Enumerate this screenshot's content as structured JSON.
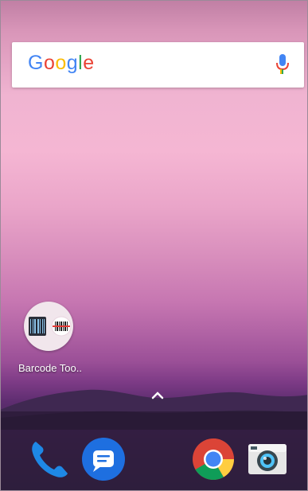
{
  "search": {
    "logo_letters": [
      "G",
      "o",
      "o",
      "g",
      "l",
      "e"
    ],
    "logo_colors": [
      "#4285F4",
      "#EA4335",
      "#FBBC05",
      "#4285F4",
      "#34A853",
      "#EA4335"
    ],
    "mic_icon": "mic-icon"
  },
  "home": {
    "app_label": "Barcode Too..",
    "app_icon": "barcode-icon"
  },
  "app_drawer": {
    "icon": "chevron-up-icon"
  },
  "dock": {
    "apps": [
      {
        "name": "phone",
        "icon": "phone-icon",
        "color": "#1E88E5"
      },
      {
        "name": "messages",
        "icon": "messages-icon",
        "color": "#1E6FE0"
      },
      {
        "name": "chrome",
        "icon": "chrome-icon",
        "color": "#DB4437"
      },
      {
        "name": "camera",
        "icon": "camera-icon",
        "color": "#455A64"
      }
    ]
  }
}
